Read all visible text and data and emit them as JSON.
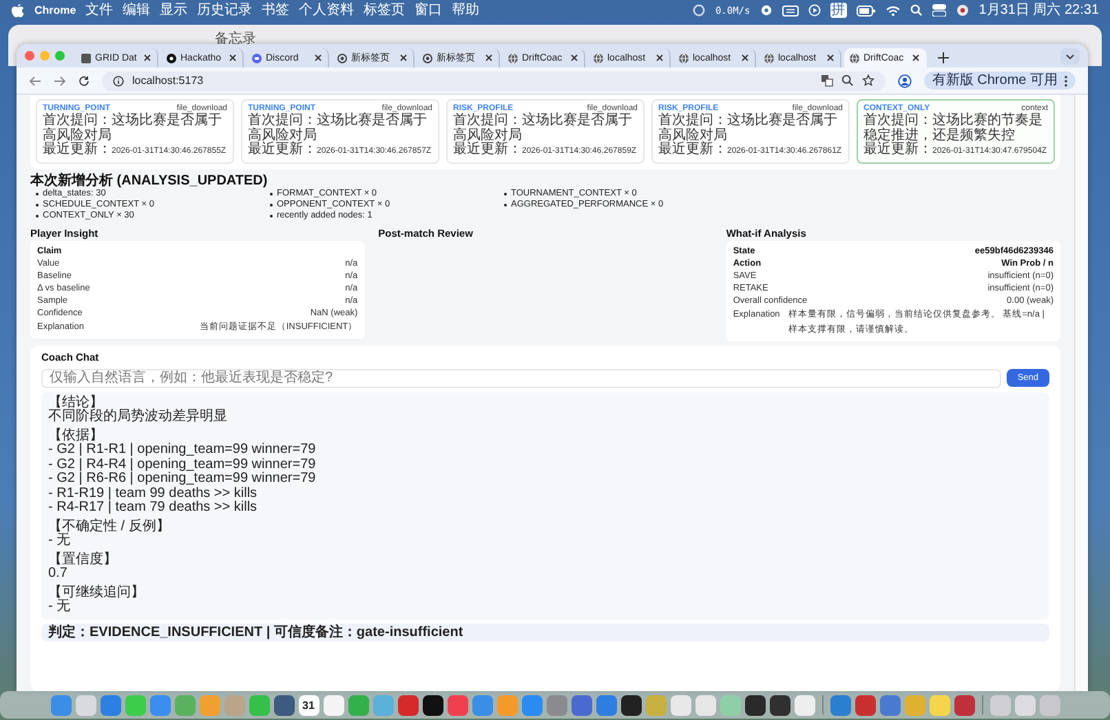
{
  "menu_bar": {
    "app": "Chrome",
    "menus": [
      "文件",
      "编辑",
      "显示",
      "历史记录",
      "书签",
      "个人资料",
      "标签页",
      "窗口",
      "帮助"
    ],
    "net_speed": "0.0M/s",
    "input_method": "拼",
    "clock": "1月31日 周六 22:31"
  },
  "background_window": {
    "title": "备忘录"
  },
  "browser": {
    "tabs": [
      {
        "title": "GRID Dat",
        "kind": "square",
        "selected": false
      },
      {
        "title": "Hackatho",
        "kind": "dark",
        "selected": false
      },
      {
        "title": "Discord",
        "kind": "discord",
        "selected": false
      },
      {
        "title": "新标签页",
        "kind": "ring",
        "selected": false
      },
      {
        "title": "新标签页",
        "kind": "ring",
        "selected": false
      },
      {
        "title": "DriftCoac",
        "kind": "globe",
        "selected": false
      },
      {
        "title": "localhost",
        "kind": "globe",
        "selected": false
      },
      {
        "title": "localhost",
        "kind": "globe",
        "selected": false
      },
      {
        "title": "localhost",
        "kind": "globe",
        "selected": false
      },
      {
        "title": "DriftCoac",
        "kind": "globe",
        "selected": true
      }
    ],
    "address": "localhost:5173",
    "update_button": "有新版 Chrome 可用"
  },
  "insight_cards": [
    {
      "type": "TURNING_POINT",
      "tag": "file_download",
      "question": "首次提问：这场比赛是否属于高风险对局",
      "updated_label": "最近更新：",
      "updated": "2026-01-31T14:30:46.267855Z",
      "selected": false
    },
    {
      "type": "TURNING_POINT",
      "tag": "file_download",
      "question": "首次提问：这场比赛是否属于高风险对局",
      "updated_label": "最近更新：",
      "updated": "2026-01-31T14:30:46.267857Z",
      "selected": false
    },
    {
      "type": "RISK_PROFILE",
      "tag": "file_download",
      "question": "首次提问：这场比赛是否属于高风险对局",
      "updated_label": "最近更新：",
      "updated": "2026-01-31T14:30:46.267859Z",
      "selected": false
    },
    {
      "type": "RISK_PROFILE",
      "tag": "file_download",
      "question": "首次提问：这场比赛是否属于高风险对局",
      "updated_label": "最近更新：",
      "updated": "2026-01-31T14:30:46.267861Z",
      "selected": false
    },
    {
      "type": "CONTEXT_ONLY",
      "tag": "context",
      "question": "首次提问：这场比赛的节奏是稳定推进，还是频繁失控",
      "updated_label": "最近更新：",
      "updated": "2026-01-31T14:30:47.679504Z",
      "selected": true
    }
  ],
  "analysis": {
    "title": "本次新增分析 (ANALYSIS_UPDATED)",
    "items": [
      "delta_states: 30",
      "FORMAT_CONTEXT × 0",
      "TOURNAMENT_CONTEXT × 0",
      "SCHEDULE_CONTEXT × 0",
      "OPPONENT_CONTEXT × 0",
      "AGGREGATED_PERFORMANCE × 0",
      "CONTEXT_ONLY × 30",
      "recently added nodes: 1"
    ]
  },
  "player_insight": {
    "title": "Player Insight",
    "rows": [
      {
        "kind": "heading",
        "label": "Claim"
      },
      {
        "kind": "row",
        "label": "Value",
        "value": "n/a"
      },
      {
        "kind": "row",
        "label": "Baseline",
        "value": "n/a"
      },
      {
        "kind": "row",
        "label": "Δ vs baseline",
        "value": "n/a"
      },
      {
        "kind": "row",
        "label": "Sample",
        "value": "n/a"
      },
      {
        "kind": "row",
        "label": "Confidence",
        "value": "NaN (weak)"
      },
      {
        "kind": "row",
        "label": "Explanation",
        "value": "当前问题证据不足（INSUFFICIENT）"
      }
    ]
  },
  "post_match_review": {
    "title": "Post-match Review"
  },
  "what_if": {
    "title": "What-if Analysis",
    "rows": [
      {
        "kind": "heading",
        "label": "State",
        "value": "ee59bf46d6239346"
      },
      {
        "kind": "heading",
        "label": "Action",
        "value": "Win Prob / n"
      },
      {
        "kind": "row",
        "label": "SAVE",
        "value": "insufficient (n=0)"
      },
      {
        "kind": "row",
        "label": "RETAKE",
        "value": "insufficient (n=0)"
      },
      {
        "kind": "row",
        "label": "Overall confidence",
        "value": "0.00 (weak)"
      },
      {
        "kind": "note",
        "label": "Explanation",
        "value": "样本量有限，信号偏弱，当前结论仅供复盘参考。 基线=n/a | 样本支撑有限，请谨慎解读。"
      }
    ]
  },
  "coach_chat": {
    "title": "Coach Chat",
    "input": {
      "placeholder": "仅输入自然语言，例如：他最近表现是否稳定?"
    },
    "send_button": "Send",
    "response": [
      {
        "heading": "【结论】",
        "lines": [
          "不同阶段的局势波动差异明显"
        ]
      },
      {
        "heading": "【依据】",
        "lines": [
          "- G2 | R1-R1 | opening_team=99 winner=79",
          "- G2 | R4-R4 | opening_team=99 winner=79",
          "- G2 | R6-R6 | opening_team=99 winner=79",
          "- R1-R19 | team 99 deaths >> kills",
          "- R4-R17 | team 79 deaths >> kills"
        ]
      },
      {
        "heading": "【不确定性 / 反例】",
        "lines": [
          "- 无"
        ]
      },
      {
        "heading": "【置信度】",
        "lines": [
          "0.7"
        ]
      },
      {
        "heading": "【可继续追问】",
        "lines": [
          "- 无"
        ]
      }
    ],
    "verdict": "判定：EVIDENCE_INSUFFICIENT | 可信度备注：gate-insufficient"
  },
  "dock": [
    {
      "kind": "app",
      "color": "#3a8ee6"
    },
    {
      "kind": "app",
      "color": "#d9d9e0"
    },
    {
      "kind": "app",
      "color": "#2d7fe0"
    },
    {
      "kind": "app",
      "color": "#3ccd4a"
    },
    {
      "kind": "app",
      "color": "#3b8def"
    },
    {
      "kind": "app",
      "color": "#5ab25e"
    },
    {
      "kind": "app",
      "color": "#f0a030"
    },
    {
      "kind": "app",
      "color": "#b8a58a"
    },
    {
      "kind": "app",
      "color": "#35c04a"
    },
    {
      "kind": "app",
      "color": "#3d5a80"
    },
    {
      "kind": "calendar",
      "label": "31"
    },
    {
      "kind": "app",
      "color": "#f4f4f4"
    },
    {
      "kind": "app",
      "color": "#33b04a"
    },
    {
      "kind": "app",
      "color": "#5ab0d8"
    },
    {
      "kind": "app",
      "color": "#d42a2a"
    },
    {
      "kind": "app",
      "color": "#111111"
    },
    {
      "kind": "app",
      "color": "#f0404f"
    },
    {
      "kind": "app",
      "color": "#3a8ee6"
    },
    {
      "kind": "app",
      "color": "#f39a2a"
    },
    {
      "kind": "app",
      "color": "#2a8cf0"
    },
    {
      "kind": "app",
      "color": "#8a8a8f"
    },
    {
      "kind": "app",
      "color": "#4a6ad0"
    },
    {
      "kind": "app",
      "color": "#2e7de0"
    },
    {
      "kind": "app",
      "color": "#222222"
    },
    {
      "kind": "app",
      "color": "#c8b040"
    },
    {
      "kind": "app",
      "color": "#e8e8e8"
    },
    {
      "kind": "app",
      "color": "#e6e6e6"
    },
    {
      "kind": "app",
      "color": "#8fcfa8"
    },
    {
      "kind": "app",
      "color": "#2a2a2a"
    },
    {
      "kind": "app",
      "color": "#303030"
    },
    {
      "kind": "app",
      "color": "#eeeeee"
    },
    {
      "kind": "divider"
    },
    {
      "kind": "app",
      "color": "#2a7fd0"
    },
    {
      "kind": "app",
      "color": "#c83030"
    },
    {
      "kind": "app",
      "color": "#4a7ad0"
    },
    {
      "kind": "app",
      "color": "#e0b030"
    },
    {
      "kind": "app",
      "color": "#f5d64a"
    },
    {
      "kind": "app",
      "color": "#c0303a"
    },
    {
      "kind": "divider"
    },
    {
      "kind": "app",
      "color": "#cfcfd4"
    },
    {
      "kind": "app",
      "color": "#dcdce0"
    },
    {
      "kind": "app",
      "color": "#c8c8cc"
    }
  ]
}
